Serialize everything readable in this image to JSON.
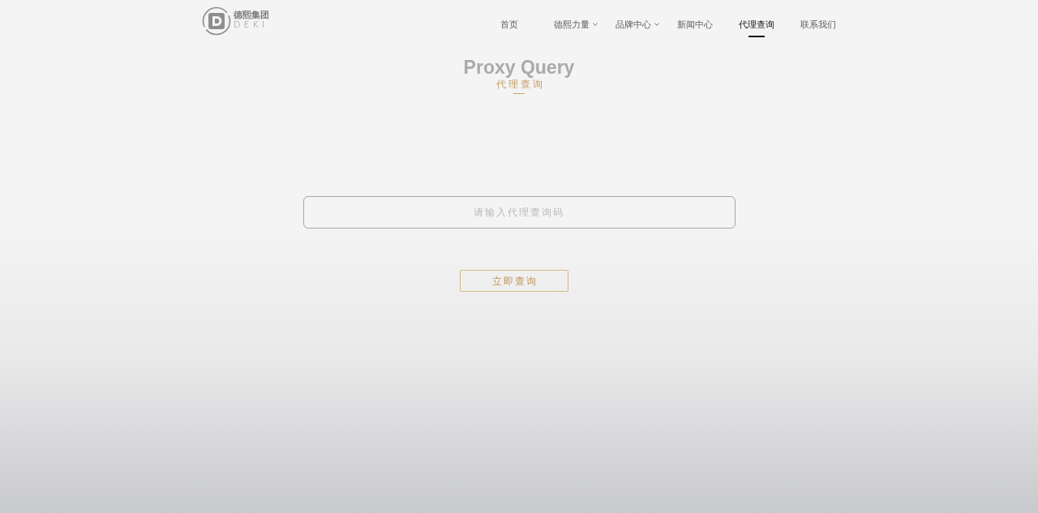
{
  "header": {
    "logo": {
      "name_cn": "德熙集团",
      "name_en": "DEKI"
    },
    "nav": [
      {
        "label": "首页",
        "has_dropdown": false,
        "selected": false
      },
      {
        "label": "德熙力量",
        "has_dropdown": true,
        "selected": false
      },
      {
        "label": "品牌中心",
        "has_dropdown": true,
        "selected": false
      },
      {
        "label": "新闻中心",
        "has_dropdown": false,
        "selected": false
      },
      {
        "label": "代理查询",
        "has_dropdown": false,
        "selected": true
      },
      {
        "label": "联系我们",
        "has_dropdown": false,
        "selected": false
      }
    ]
  },
  "heading": {
    "background_title": "Proxy Query",
    "title": "代理查询"
  },
  "query_form": {
    "placeholder": "请输入代理查询码",
    "submit": "立即查询"
  }
}
